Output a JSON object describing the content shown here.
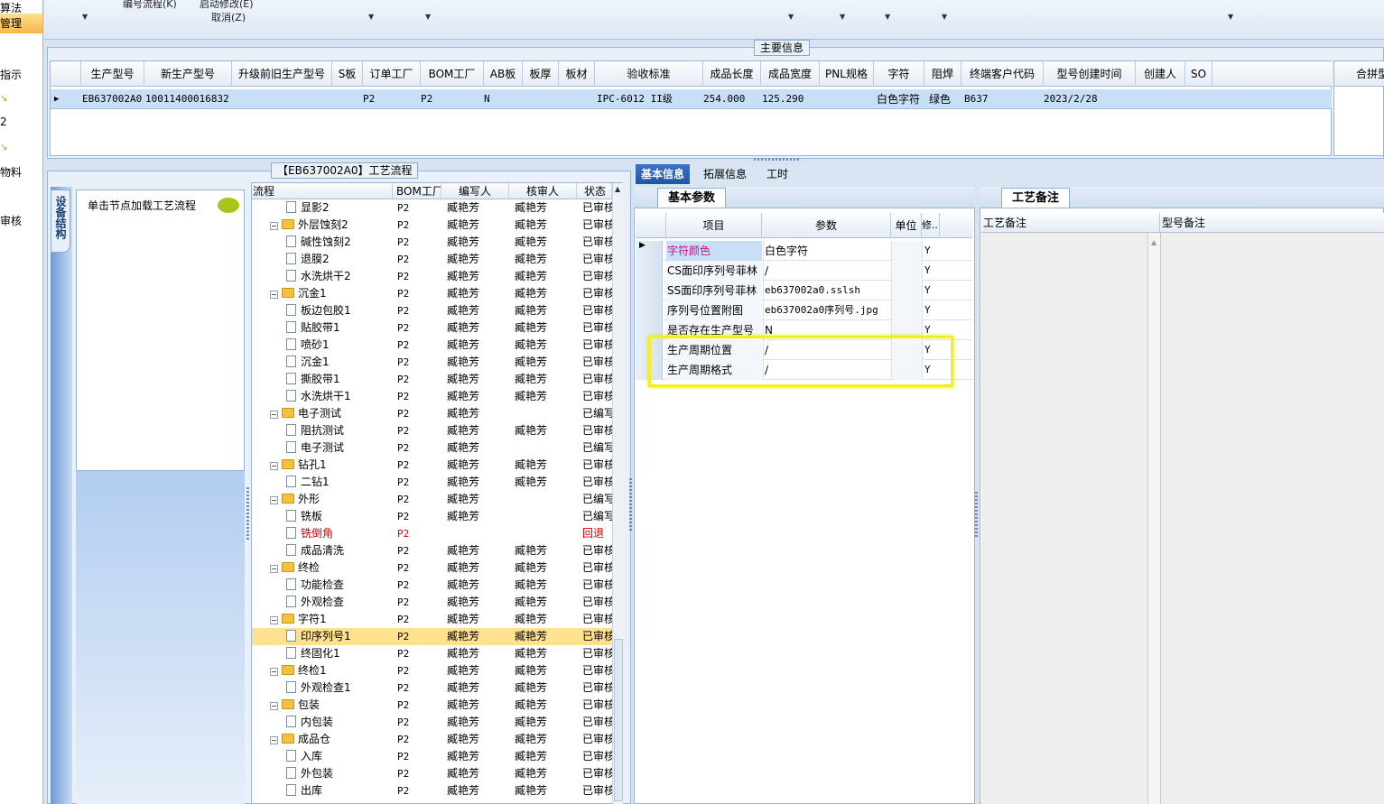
{
  "leftnav": {
    "items": [
      "算法",
      "管理",
      "指示",
      "2",
      "物料",
      "审核"
    ]
  },
  "toolbar": {
    "menus": [
      "编号流程(K)",
      "启动修改(E)",
      "取消(Z)"
    ]
  },
  "main_info": {
    "title": "主要信息",
    "right_title": "合拼型",
    "columns": [
      "生产型号",
      "新生产型号",
      "升级前旧生产型号",
      "S板",
      "订单工厂",
      "BOM工厂",
      "AB板",
      "板厚",
      "板材",
      "验收标准",
      "成品长度",
      "成品宽度",
      "PNL规格",
      "字符",
      "阻焊",
      "终端客户代码",
      "型号创建时间",
      "创建人",
      "SO"
    ],
    "row": {
      "model": "EB637002A0",
      "new_model": "10011400016832",
      "order_factory": "P2",
      "bom_factory": "P2",
      "ab": "N",
      "standard": "IPC-6012 II级",
      "length": "254.000",
      "width": "125.290",
      "char": "白色字符",
      "mask": "绿色",
      "customer": "B637",
      "created": "2023/2/28"
    }
  },
  "device_panel": {
    "vertical_tab": "设备结构",
    "hint": "单击节点加载工艺流程"
  },
  "process": {
    "title": "【EB637002A0】工艺流程",
    "columns": [
      "流程",
      "BOM工厂",
      "编写人",
      "核审人",
      "状态"
    ],
    "rows": [
      {
        "name": "显影2",
        "bom": "P2",
        "writer": "臧艳芳",
        "reviewer": "臧艳芳",
        "status": "已审核",
        "type": "leaf"
      },
      {
        "name": "外层蚀刻2",
        "bom": "P2",
        "writer": "臧艳芳",
        "reviewer": "臧艳芳",
        "status": "已审核",
        "type": "folder"
      },
      {
        "name": "碱性蚀刻2",
        "bom": "P2",
        "writer": "臧艳芳",
        "reviewer": "臧艳芳",
        "status": "已审核",
        "type": "leaf"
      },
      {
        "name": "退膜2",
        "bom": "P2",
        "writer": "臧艳芳",
        "reviewer": "臧艳芳",
        "status": "已审核",
        "type": "leaf"
      },
      {
        "name": "水洗烘干2",
        "bom": "P2",
        "writer": "臧艳芳",
        "reviewer": "臧艳芳",
        "status": "已审核",
        "type": "leaf"
      },
      {
        "name": "沉金1",
        "bom": "P2",
        "writer": "臧艳芳",
        "reviewer": "臧艳芳",
        "status": "已审核",
        "type": "folder"
      },
      {
        "name": "板边包胶1",
        "bom": "P2",
        "writer": "臧艳芳",
        "reviewer": "臧艳芳",
        "status": "已审核",
        "type": "leaf"
      },
      {
        "name": "贴胶带1",
        "bom": "P2",
        "writer": "臧艳芳",
        "reviewer": "臧艳芳",
        "status": "已审核",
        "type": "leaf"
      },
      {
        "name": "喷砂1",
        "bom": "P2",
        "writer": "臧艳芳",
        "reviewer": "臧艳芳",
        "status": "已审核",
        "type": "leaf"
      },
      {
        "name": "沉金1",
        "bom": "P2",
        "writer": "臧艳芳",
        "reviewer": "臧艳芳",
        "status": "已审核",
        "type": "leaf"
      },
      {
        "name": "撕胶带1",
        "bom": "P2",
        "writer": "臧艳芳",
        "reviewer": "臧艳芳",
        "status": "已审核",
        "type": "leaf"
      },
      {
        "name": "水洗烘干1",
        "bom": "P2",
        "writer": "臧艳芳",
        "reviewer": "臧艳芳",
        "status": "已审核",
        "type": "leaf"
      },
      {
        "name": "电子测试",
        "bom": "P2",
        "writer": "臧艳芳",
        "reviewer": "",
        "status": "已编写",
        "type": "folder"
      },
      {
        "name": "阻抗测试",
        "bom": "P2",
        "writer": "臧艳芳",
        "reviewer": "臧艳芳",
        "status": "已审核",
        "type": "leaf"
      },
      {
        "name": "电子测试",
        "bom": "P2",
        "writer": "臧艳芳",
        "reviewer": "",
        "status": "已编写",
        "type": "leaf"
      },
      {
        "name": "钻孔1",
        "bom": "P2",
        "writer": "臧艳芳",
        "reviewer": "臧艳芳",
        "status": "已审核",
        "type": "folder"
      },
      {
        "name": "二钻1",
        "bom": "P2",
        "writer": "臧艳芳",
        "reviewer": "臧艳芳",
        "status": "已审核",
        "type": "leaf"
      },
      {
        "name": "外形",
        "bom": "P2",
        "writer": "臧艳芳",
        "reviewer": "",
        "status": "已编写",
        "type": "folder"
      },
      {
        "name": "铣板",
        "bom": "P2",
        "writer": "臧艳芳",
        "reviewer": "",
        "status": "已编写",
        "type": "leaf"
      },
      {
        "name": "铣倒角",
        "bom": "P2",
        "writer": "",
        "reviewer": "",
        "status": "回退",
        "type": "leaf",
        "red": true
      },
      {
        "name": "成品清洗",
        "bom": "P2",
        "writer": "臧艳芳",
        "reviewer": "臧艳芳",
        "status": "已审核",
        "type": "leaf"
      },
      {
        "name": "终检",
        "bom": "P2",
        "writer": "臧艳芳",
        "reviewer": "臧艳芳",
        "status": "已审核",
        "type": "folder"
      },
      {
        "name": "功能检查",
        "bom": "P2",
        "writer": "臧艳芳",
        "reviewer": "臧艳芳",
        "status": "已审核",
        "type": "leaf"
      },
      {
        "name": "外观检查",
        "bom": "P2",
        "writer": "臧艳芳",
        "reviewer": "臧艳芳",
        "status": "已审核",
        "type": "leaf"
      },
      {
        "name": "字符1",
        "bom": "P2",
        "writer": "臧艳芳",
        "reviewer": "臧艳芳",
        "status": "已审核",
        "type": "folder"
      },
      {
        "name": "印序列号1",
        "bom": "P2",
        "writer": "臧艳芳",
        "reviewer": "臧艳芳",
        "status": "已审核",
        "type": "leaf",
        "selected": true
      },
      {
        "name": "终固化1",
        "bom": "P2",
        "writer": "臧艳芳",
        "reviewer": "臧艳芳",
        "status": "已审核",
        "type": "leaf"
      },
      {
        "name": "终检1",
        "bom": "P2",
        "writer": "臧艳芳",
        "reviewer": "臧艳芳",
        "status": "已审核",
        "type": "folder"
      },
      {
        "name": "外观检查1",
        "bom": "P2",
        "writer": "臧艳芳",
        "reviewer": "臧艳芳",
        "status": "已审核",
        "type": "leaf"
      },
      {
        "name": "包装",
        "bom": "P2",
        "writer": "臧艳芳",
        "reviewer": "臧艳芳",
        "status": "已审核",
        "type": "folder"
      },
      {
        "name": "内包装",
        "bom": "P2",
        "writer": "臧艳芳",
        "reviewer": "臧艳芳",
        "status": "已审核",
        "type": "leaf"
      },
      {
        "name": "成品仓",
        "bom": "P2",
        "writer": "臧艳芳",
        "reviewer": "臧艳芳",
        "status": "已审核",
        "type": "folder"
      },
      {
        "name": "入库",
        "bom": "P2",
        "writer": "臧艳芳",
        "reviewer": "臧艳芳",
        "status": "已审核",
        "type": "leaf"
      },
      {
        "name": "外包装",
        "bom": "P2",
        "writer": "臧艳芳",
        "reviewer": "臧艳芳",
        "status": "已审核",
        "type": "leaf"
      },
      {
        "name": "出库",
        "bom": "P2",
        "writer": "臧艳芳",
        "reviewer": "臧艳芳",
        "status": "已审核",
        "type": "leaf"
      }
    ]
  },
  "detail_tabs": [
    "基本信息",
    "拓展信息",
    "工时"
  ],
  "basic_params": {
    "title": "基本参数",
    "columns": [
      "项目",
      "参数",
      "单位",
      "修..."
    ],
    "rows": [
      {
        "item": "字符颜色",
        "value": "白色字符",
        "unit": "",
        "mod": "Y",
        "pink": true,
        "current": true
      },
      {
        "item": "CS面印序列号菲林",
        "value": "/",
        "unit": "",
        "mod": "Y"
      },
      {
        "item": "SS面印序列号菲林",
        "value": "eb637002a0.sslsh",
        "unit": "",
        "mod": "Y"
      },
      {
        "item": "序列号位置附图",
        "value": "eb637002a0序列号.jpg",
        "unit": "",
        "mod": "Y"
      },
      {
        "item": "是否存在生产型号",
        "value": "N",
        "unit": "",
        "mod": "Y"
      },
      {
        "item": "生产周期位置",
        "value": "/",
        "unit": "",
        "mod": "Y"
      },
      {
        "item": "生产周期格式",
        "value": "/",
        "unit": "",
        "mod": "Y"
      }
    ]
  },
  "process_notes": {
    "title": "工艺备注",
    "col1": "工艺备注",
    "col2": "型号备注"
  },
  "colors": {
    "accent": "#1d55a8",
    "selected_row": "#c7e0f7",
    "tree_selected": "#ffe28f",
    "highlight_box": "#f0f020",
    "pink": "#d0108a",
    "red": "#d00000"
  }
}
